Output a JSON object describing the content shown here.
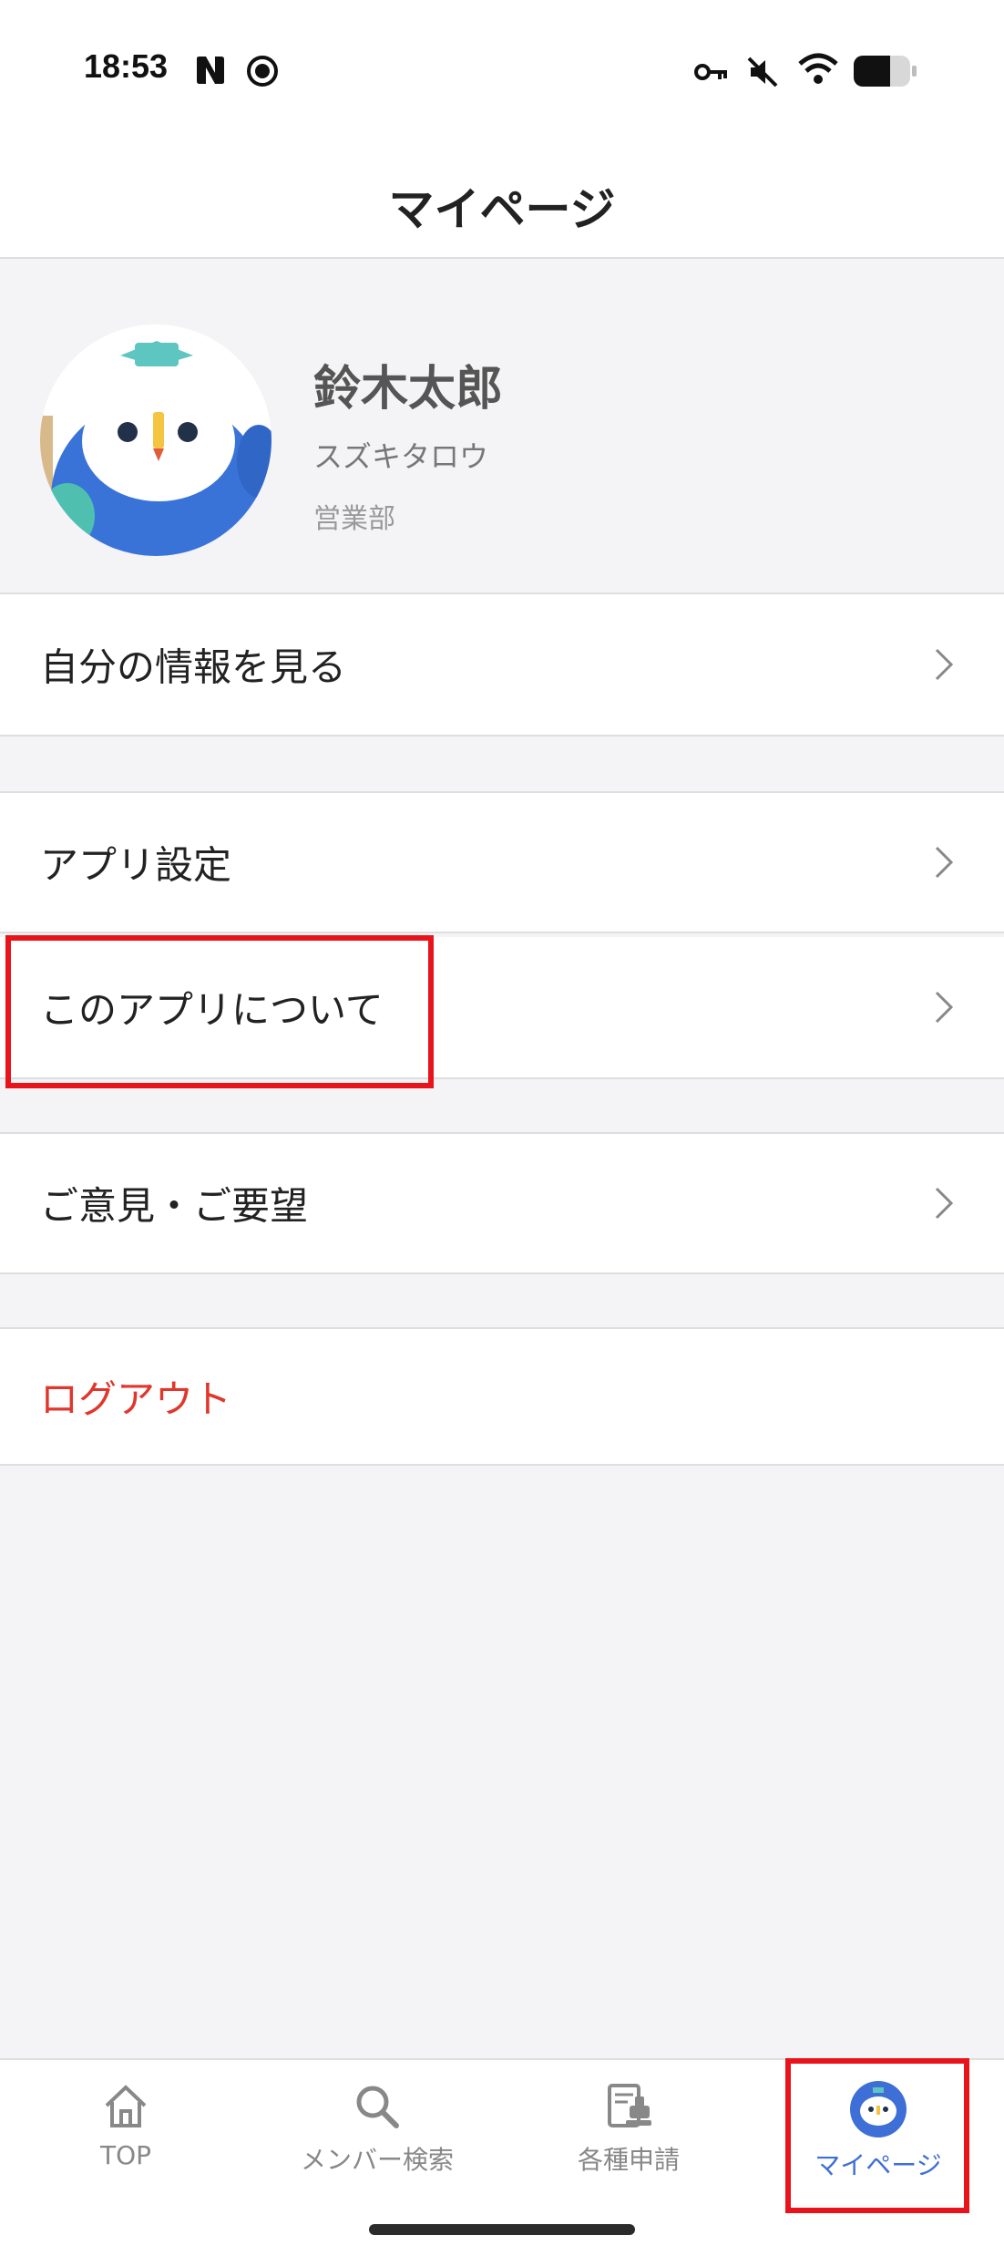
{
  "status_bar": {
    "time": "18:53",
    "icons": [
      "n-app-icon",
      "record-icon",
      "key-icon",
      "mute-icon",
      "wifi-icon",
      "battery-icon"
    ]
  },
  "nav": {
    "title": "マイページ"
  },
  "profile": {
    "name": "鈴木太郎",
    "kana": "スズキタロウ",
    "department": "営業部",
    "avatar_icon": "owl-mascot-icon"
  },
  "menu": {
    "view_my_info": "自分の情報を見る",
    "app_settings": "アプリ設定",
    "about_app": "このアプリについて",
    "feedback": "ご意見・ご要望",
    "logout": "ログアウト"
  },
  "tabs": [
    {
      "label": "TOP",
      "icon": "home-icon",
      "active": false
    },
    {
      "label": "メンバー検索",
      "icon": "search-icon",
      "active": false
    },
    {
      "label": "各種申請",
      "icon": "application-form-icon",
      "active": false
    },
    {
      "label": "マイページ",
      "icon": "owl-mascot-icon",
      "active": true
    }
  ],
  "colors": {
    "accent": "#3d6fd6",
    "danger": "#e0362c",
    "highlight": "#e8131b",
    "background": "#f4f4f6"
  }
}
